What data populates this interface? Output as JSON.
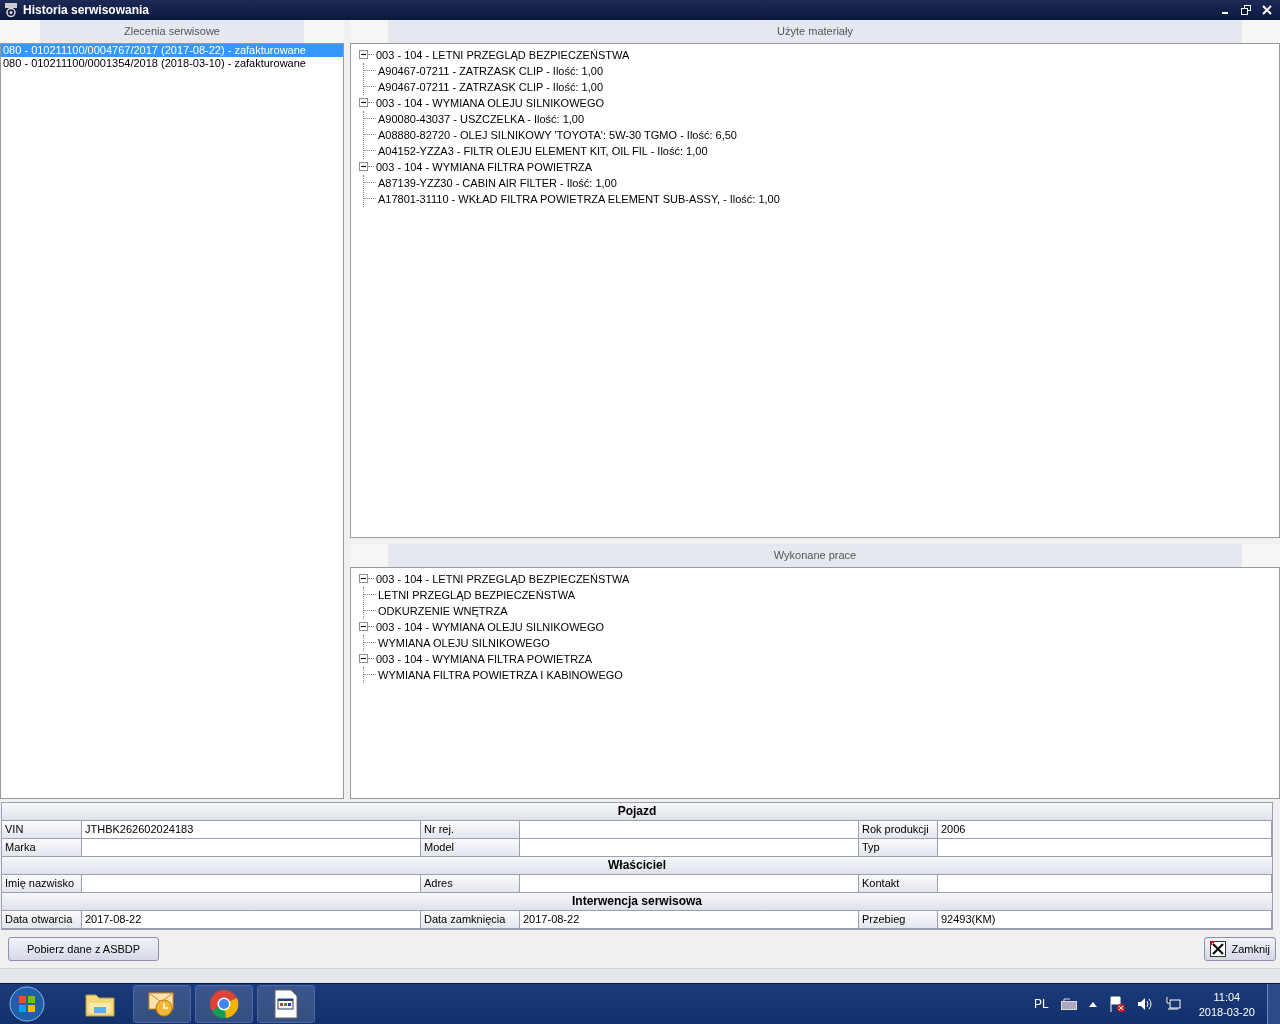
{
  "window": {
    "title": "Historia serwisowania"
  },
  "orders": {
    "header": "Zlecenia serwisowe",
    "items": [
      {
        "label": "080 - 010211100/0004767/2017 (2017-08-22) - zafakturowane",
        "selected": true
      },
      {
        "label": "080 - 010211100/0001354/2018 (2018-03-10) - zafakturowane",
        "selected": false
      }
    ]
  },
  "materials": {
    "header": "Użyte materiały",
    "groups": [
      {
        "label": "003 - 104 - LETNI PRZEGLĄD BEZPIECZEŃSTWA",
        "expanded": true,
        "children": [
          {
            "label": "A90467-07211 - ZATRZASK CLIP - Ilość: 1,00"
          },
          {
            "label": "A90467-07211 - ZATRZASK CLIP - Ilość: 1,00"
          }
        ]
      },
      {
        "label": "003 - 104 - WYMIANA OLEJU SILNIKOWEGO",
        "expanded": true,
        "children": [
          {
            "label": "A90080-43037 - USZCZELKA - Ilość: 1,00"
          },
          {
            "label": "A08880-82720 - OLEJ SILNIKOWY 'TOYOTA': 5W-30 TGMO - Ilość: 6,50"
          },
          {
            "label": "A04152-YZZA3 - FILTR OLEJU ELEMENT KIT, OIL FIL - Ilość: 1,00"
          }
        ]
      },
      {
        "label": "003 - 104 - WYMIANA FILTRA POWIETRZA",
        "expanded": true,
        "children": [
          {
            "label": "A87139-YZZ30 - CABIN AIR FILTER - Ilość: 1,00"
          },
          {
            "label": "A17801-31110 - WKŁAD FILTRA POWIETRZA ELEMENT SUB-ASSY, - Ilość: 1,00"
          }
        ]
      }
    ]
  },
  "works": {
    "header": "Wykonane prace",
    "groups": [
      {
        "label": "003 - 104 - LETNI PRZEGLĄD BEZPIECZEŃSTWA",
        "expanded": true,
        "children": [
          {
            "label": "LETNI PRZEGLĄD BEZPIECZEŃSTWA"
          },
          {
            "label": "ODKURZENIE WNĘTRZA"
          }
        ]
      },
      {
        "label": "003 - 104 - WYMIANA OLEJU SILNIKOWEGO",
        "expanded": true,
        "children": [
          {
            "label": "WYMIANA OLEJU SILNIKOWEGO"
          }
        ]
      },
      {
        "label": "003 - 104 - WYMIANA FILTRA POWIETRZA",
        "expanded": true,
        "children": [
          {
            "label": "WYMIANA FILTRA POWIETRZA I KABINOWEGO"
          }
        ]
      }
    ]
  },
  "details": {
    "sections": [
      {
        "title": "Pojazd",
        "rows": [
          [
            {
              "label": "VIN",
              "value": "JTHBK262602024183"
            },
            {
              "label": "Nr rej."
            },
            {
              "label": "Rok produkcji",
              "value": "2006"
            }
          ],
          [
            {
              "label": "Marka"
            },
            {
              "label": "Model"
            },
            {
              "label": "Typ"
            }
          ]
        ]
      },
      {
        "title": "Właściciel",
        "rows": [
          [
            {
              "label": "Imię nazwisko"
            },
            {
              "label": "Adres"
            },
            {
              "label": "Kontakt"
            }
          ]
        ]
      },
      {
        "title": "Interwencja serwisowa",
        "rows": [
          [
            {
              "label": "Data otwarcia",
              "value": "2017-08-22"
            },
            {
              "label": "Data zamknięcia",
              "value": "2017-08-22"
            },
            {
              "label": "Przebieg",
              "value": "92493(KM)"
            }
          ]
        ]
      }
    ]
  },
  "buttons": {
    "fetch": "Pobierz dane z ASBDP",
    "close": "Zamknij"
  },
  "taskbar": {
    "items": [
      {
        "kind": "folder"
      },
      {
        "kind": "mail"
      },
      {
        "kind": "browser"
      },
      {
        "kind": "app"
      }
    ],
    "language": "PL",
    "time": "11:04",
    "date": "2018-03-20"
  }
}
